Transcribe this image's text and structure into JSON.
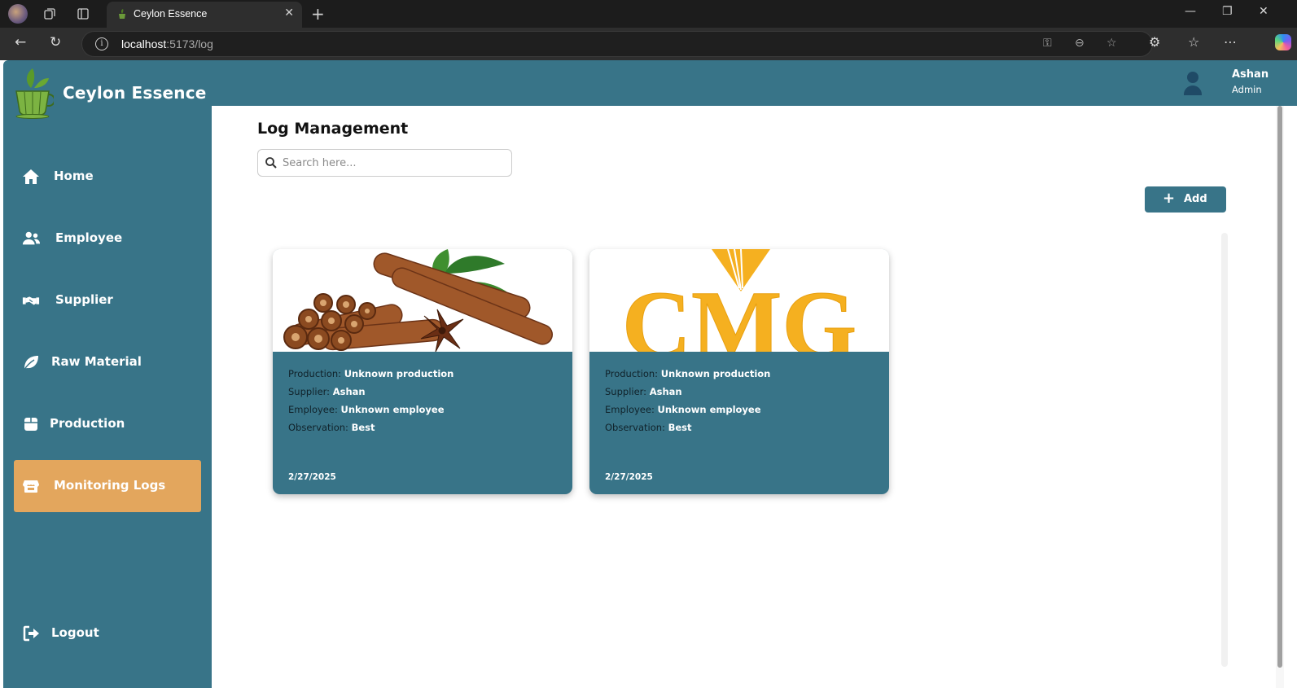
{
  "browser": {
    "tab_title": "Ceylon Essence",
    "url_host": "localhost",
    "url_rest": ":5173/log"
  },
  "app": {
    "brand": "Ceylon Essence",
    "sidebar": {
      "items": [
        {
          "label": "Home",
          "icon": "home-icon"
        },
        {
          "label": "Employee",
          "icon": "users-icon"
        },
        {
          "label": "Supplier",
          "icon": "handshake-icon"
        },
        {
          "label": "Raw Material",
          "icon": "leaf-icon"
        },
        {
          "label": "Production",
          "icon": "box-icon"
        },
        {
          "label": "Monitoring Logs",
          "icon": "store-icon",
          "active": true
        }
      ],
      "logout": "Logout"
    },
    "user": {
      "name": "Ashan",
      "role": "Admin"
    },
    "accent_colors": {
      "primary": "#387488",
      "active": "#e3a65d"
    }
  },
  "main": {
    "title": "Log Management",
    "search": {
      "placeholder": "Search here..."
    },
    "add_label": "Add",
    "cards": [
      {
        "image": "cinnamon-sticks-image",
        "production_label": "Production:",
        "production": "Unknown production",
        "supplier_label": "Supplier:",
        "supplier": "Ashan",
        "employee_label": "Employee:",
        "employee": "Unknown employee",
        "observation_label": "Observation:",
        "observation": "Best",
        "date": "2/27/2025"
      },
      {
        "image": "cmg-logo-image",
        "image_text": "CMG",
        "production_label": "Production:",
        "production": "Unknown production",
        "supplier_label": "Supplier:",
        "supplier": "Ashan",
        "employee_label": "Employee:",
        "employee": "Unknown employee",
        "observation_label": "Observation:",
        "observation": "Best",
        "date": "2/27/2025"
      }
    ]
  }
}
